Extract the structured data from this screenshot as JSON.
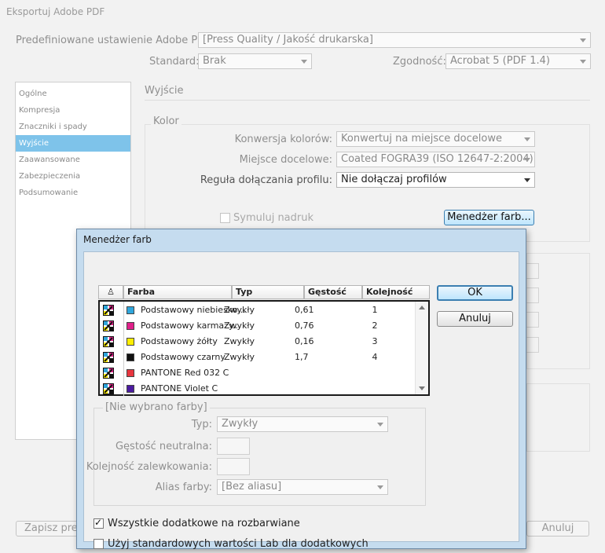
{
  "window": {
    "title": "Eksportuj Adobe PDF"
  },
  "header": {
    "preset_label": "Predefiniowane ustawienie Adobe PDF:",
    "preset_value": "[Press Quality / Jakość drukarska]",
    "standard_label": "Standard:",
    "standard_value": "Brak",
    "compat_label": "Zgodność:",
    "compat_value": "Acrobat 5 (PDF 1.4)"
  },
  "sidebar": {
    "items": [
      {
        "label": "Ogólne"
      },
      {
        "label": "Kompresja"
      },
      {
        "label": "Znaczniki i spady"
      },
      {
        "label": "Wyjście"
      },
      {
        "label": "Zaawansowane"
      },
      {
        "label": "Zabezpieczenia"
      },
      {
        "label": "Podsumowanie"
      }
    ]
  },
  "output": {
    "section_title": "Wyjście",
    "color_group": "Kolor",
    "conversion_label": "Konwersja kolorów:",
    "conversion_value": "Konwertuj na miejsce docelowe",
    "destination_label": "Miejsce docelowe:",
    "destination_value": "Coated FOGRA39 (ISO 12647-2:2004)",
    "profile_rule_label": "Reguła dołączania profilu:",
    "profile_rule_value": "Nie dołączaj profilów",
    "simulate_label": "Symuluj nadruk",
    "ink_manager_button": "Menedżer farb..."
  },
  "footer": {
    "save_preset_label": "Zapisz prede",
    "cancel_label": "Anuluj"
  },
  "dialog": {
    "title": "Menedżer farb",
    "columns": [
      "Farba",
      "Typ",
      "Gęstość",
      "Kolejność"
    ],
    "inks": [
      {
        "name": "Podstawowy niebiesko...",
        "type": "Zwykły",
        "density": "0,61",
        "order": "1",
        "color": "#2fa6dc",
        "kind": "process"
      },
      {
        "name": "Podstawowy karmazy...",
        "type": "Zwykły",
        "density": "0,76",
        "order": "2",
        "color": "#e0208a",
        "kind": "process"
      },
      {
        "name": "Podstawowy żółty",
        "type": "Zwykły",
        "density": "0,16",
        "order": "3",
        "color": "#ffee00",
        "kind": "process"
      },
      {
        "name": "Podstawowy czarny",
        "type": "Zwykły",
        "density": "1,7",
        "order": "4",
        "color": "#111111",
        "kind": "process"
      },
      {
        "name": "PANTONE Red 032 C",
        "type": "",
        "density": "",
        "order": "",
        "color": "#e8353e",
        "kind": "spot"
      },
      {
        "name": "PANTONE Violet C",
        "type": "",
        "density": "",
        "order": "",
        "color": "#4b1ba0",
        "kind": "spot"
      }
    ],
    "ok_label": "OK",
    "cancel_label": "Anuluj",
    "no_selection_label": "[Nie wybrano farby]",
    "type_label": "Typ:",
    "type_value": "Zwykły",
    "neutral_density_label": "Gęstość neutralna:",
    "trapping_order_label": "Kolejność zalewkowania:",
    "ink_alias_label": "Alias farby:",
    "ink_alias_value": "[Bez aliasu]",
    "all_spots_label": "Wszystkie dodatkowe na rozbarwiane",
    "all_spots_checked": true,
    "use_lab_label": "Użyj standardowych wartości Lab dla dodatkowych",
    "use_lab_checked": false
  }
}
